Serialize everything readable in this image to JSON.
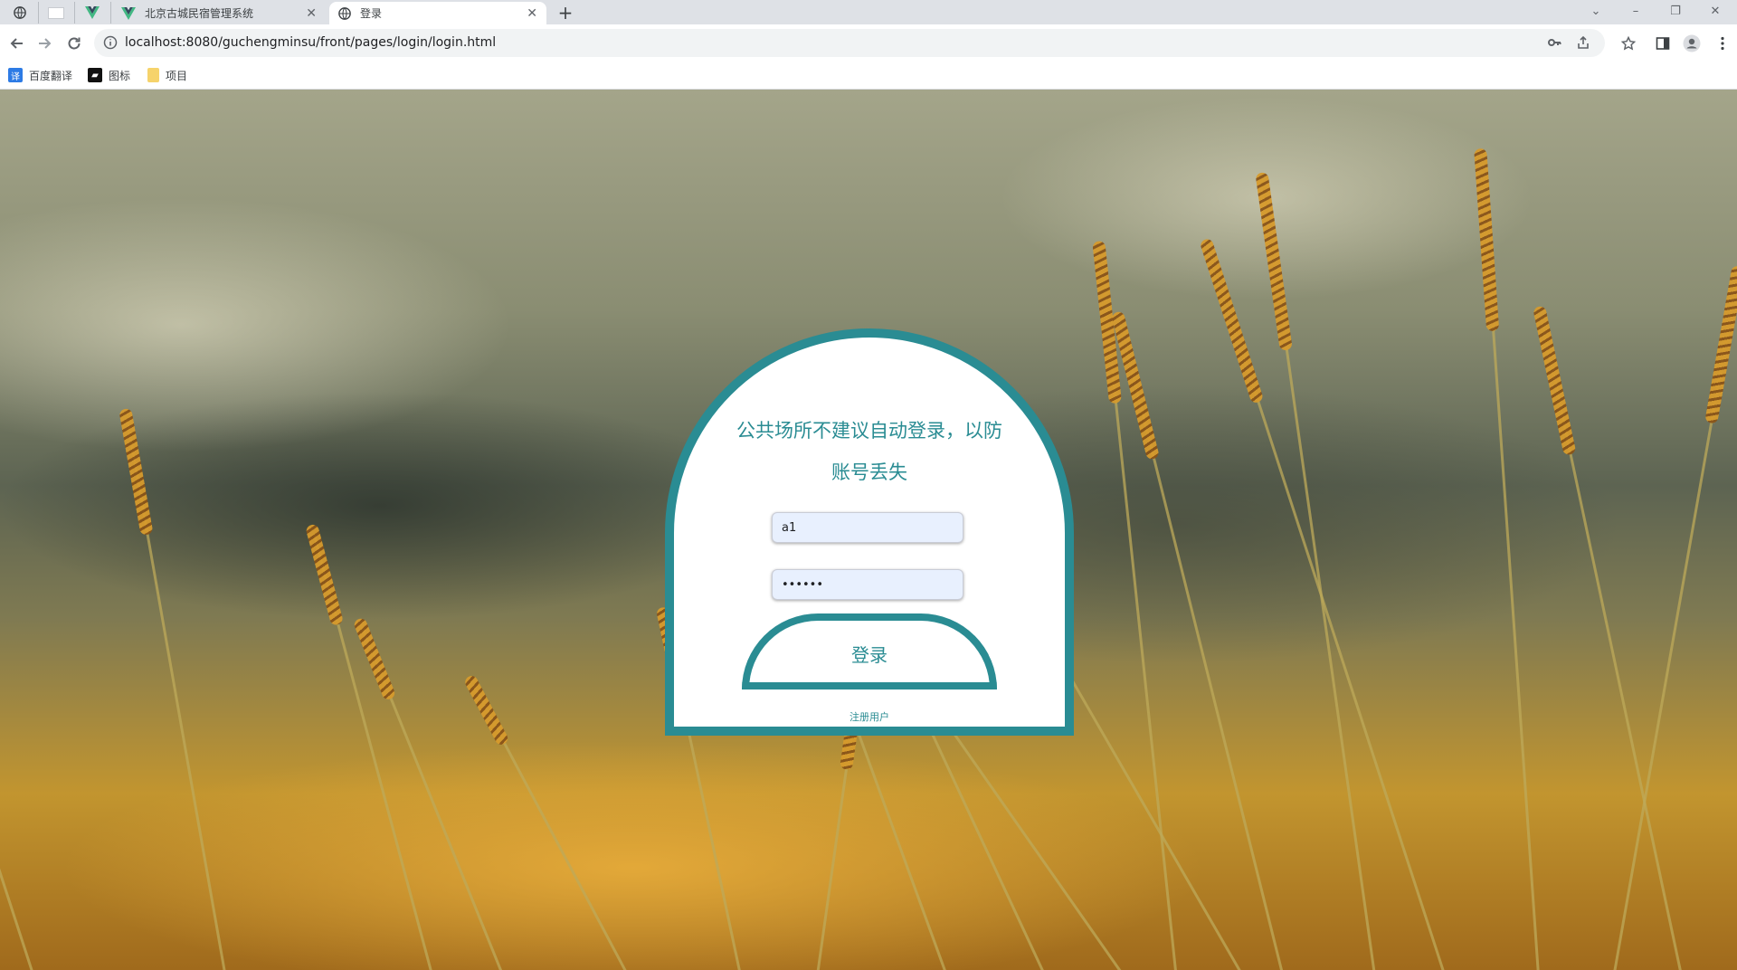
{
  "browser": {
    "tabs": [
      {
        "title": "北京古城民宿管理系统",
        "icon": "vue-logo-icon",
        "active": false
      },
      {
        "title": "登录",
        "icon": "globe-icon",
        "active": true
      }
    ],
    "new_tab_label": "+",
    "url": "localhost:8080/guchengminsu/front/pages/login/login.html",
    "bookmarks": [
      {
        "label": "百度翻译",
        "icon": "baidu-translate-icon"
      },
      {
        "label": "图标",
        "icon": "iconfont-icon"
      },
      {
        "label": "项目",
        "icon": "folder-icon"
      }
    ]
  },
  "login": {
    "notice": "公共场所不建议自动登录，以防账号丢失",
    "username_value": "a1",
    "password_value": "••••••",
    "submit_label": "登录",
    "register_label": "注册用户"
  },
  "colors": {
    "accent": "#2a8c93",
    "input_bg": "#e8f0fe"
  }
}
